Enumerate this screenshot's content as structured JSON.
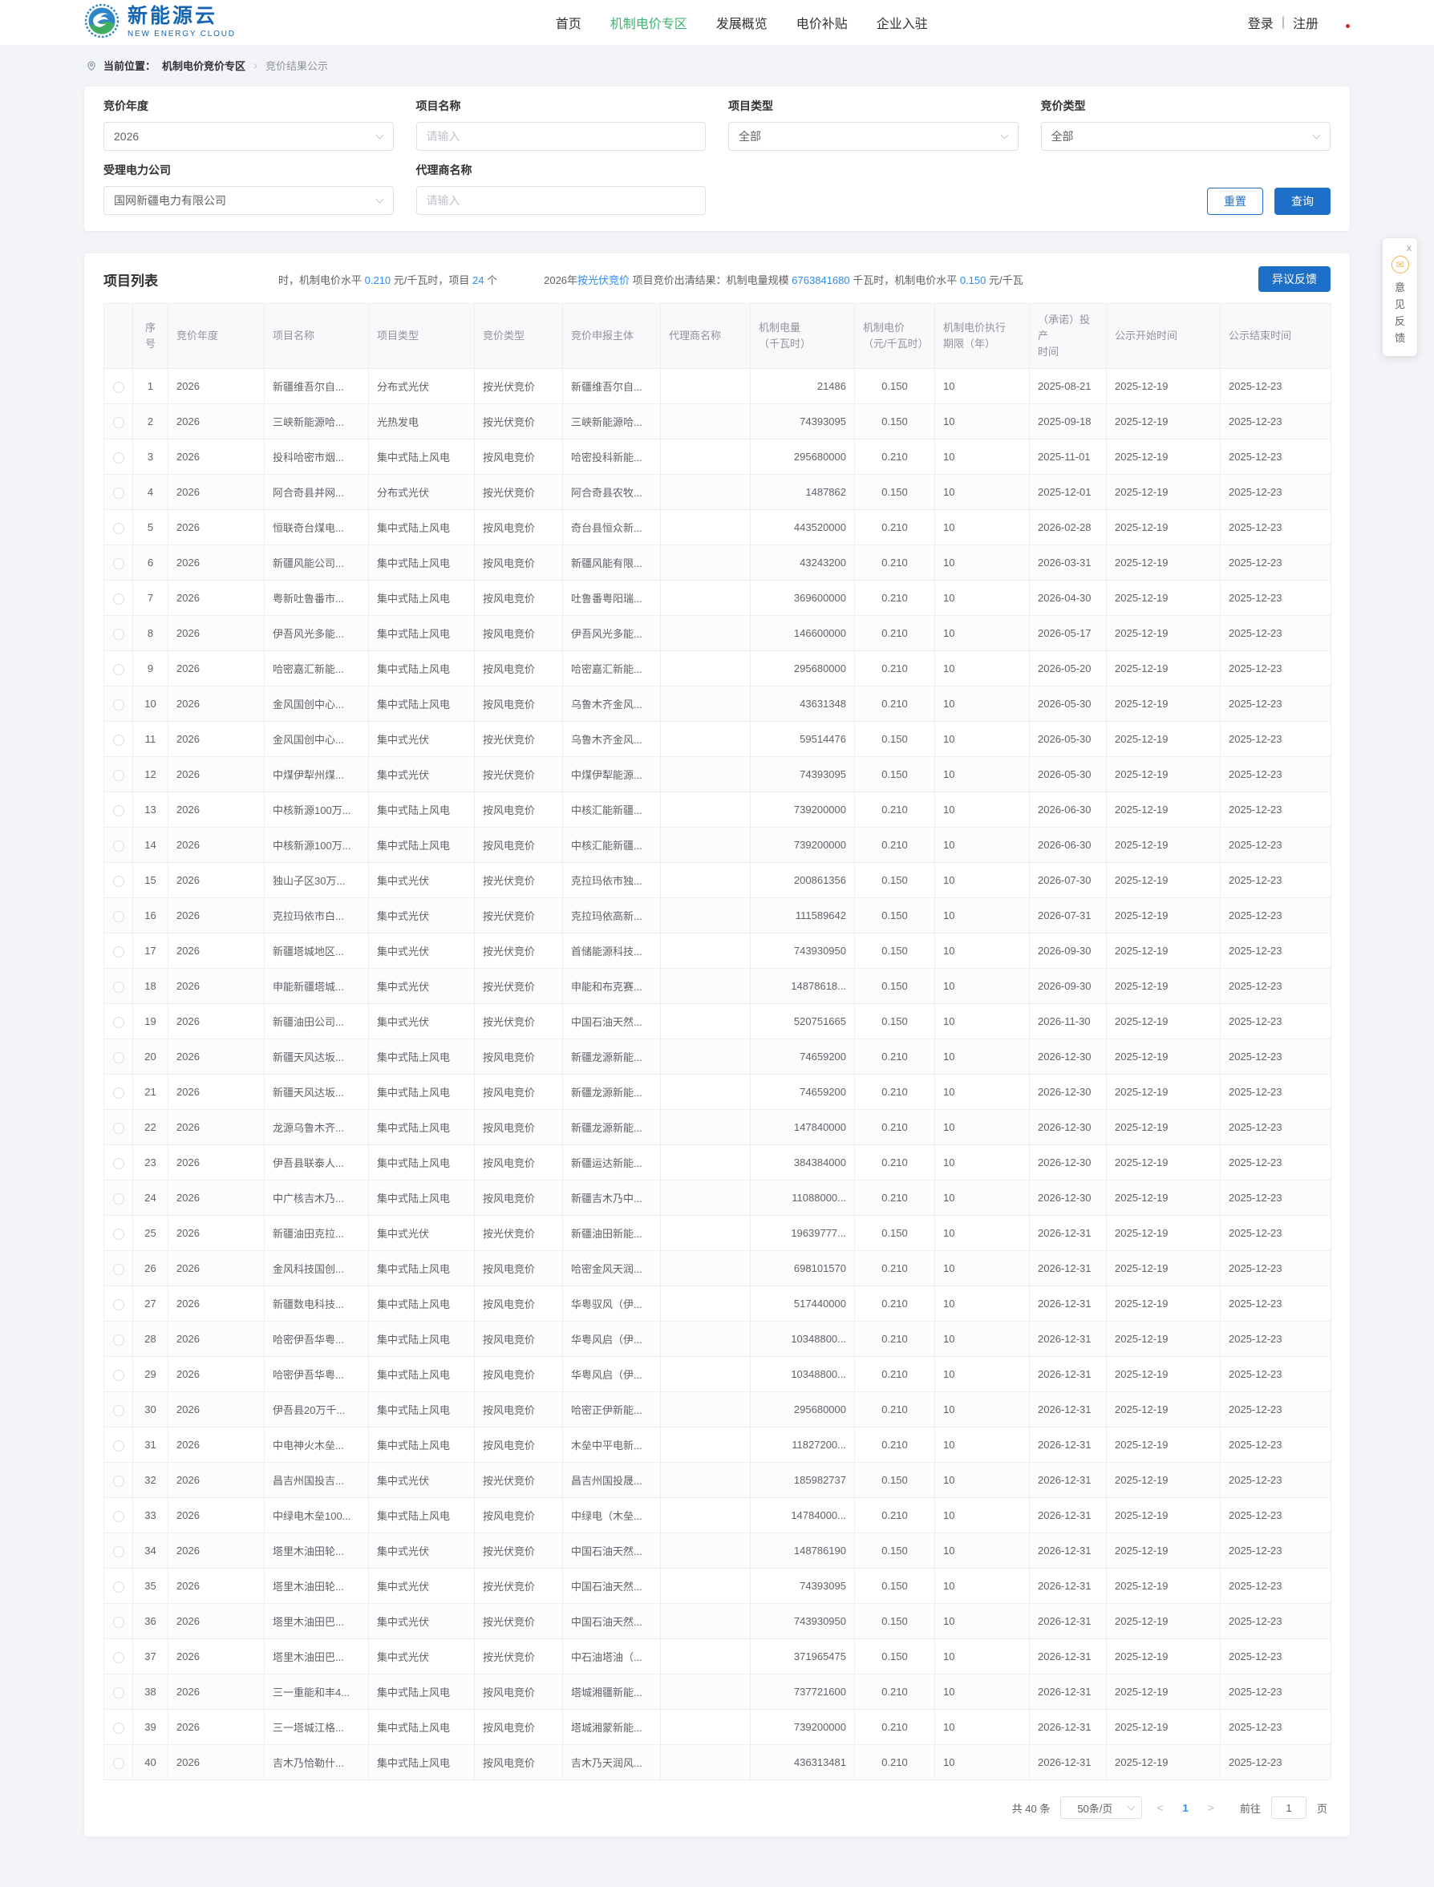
{
  "header": {
    "logo": {
      "title": "新能源云",
      "subtitle": "NEW ENERGY CLOUD"
    },
    "nav": [
      {
        "key": "home",
        "label": "首页",
        "active": false
      },
      {
        "key": "mechanism-price-zone",
        "label": "机制电价专区",
        "active": true
      },
      {
        "key": "development-overview",
        "label": "发展概览",
        "active": false
      },
      {
        "key": "price-subsidy",
        "label": "电价补贴",
        "active": false
      },
      {
        "key": "enterprise-entry",
        "label": "企业入驻",
        "active": false
      }
    ],
    "login": "登录",
    "divider": "|",
    "register": "注册"
  },
  "breadcrumb": {
    "prefix": "当前位置：",
    "section": "机制电价竞价专区",
    "separator": "›",
    "current": "竞价结果公示"
  },
  "filters": {
    "fields": [
      {
        "key": "bidding-year",
        "label": "竞价年度",
        "type": "select",
        "value": "2026"
      },
      {
        "key": "project-name",
        "label": "项目名称",
        "type": "input",
        "placeholder": "请输入"
      },
      {
        "key": "project-type",
        "label": "项目类型",
        "type": "select",
        "value": "全部"
      },
      {
        "key": "bidding-type",
        "label": "竞价类型",
        "type": "select",
        "value": "全部"
      },
      {
        "key": "power-company",
        "label": "受理电力公司",
        "type": "select",
        "value": "国网新疆电力有限公司"
      },
      {
        "key": "agent-name",
        "label": "代理商名称",
        "type": "input",
        "placeholder": "请输入"
      }
    ],
    "reset_label": "重置",
    "search_label": "查询"
  },
  "list": {
    "title": "项目列表",
    "announcement": [
      {
        "text": "时，机制电价水平 "
      },
      {
        "text": "0.210",
        "highlight": true
      },
      {
        "text": " 元/千瓦时，项目 "
      },
      {
        "text": "24",
        "highlight": true
      },
      {
        "text": " 个"
      },
      {
        "text": "2026年 ",
        "gap": true
      },
      {
        "text": "按光伏竞价",
        "highlight": true
      },
      {
        "text": " 项目竞价出清结果：机制电量规模 "
      },
      {
        "text": "6763841680",
        "highlight": true
      },
      {
        "text": " 千瓦时，机制电价水平 "
      },
      {
        "text": "0.150",
        "highlight": true
      },
      {
        "text": " 元/千瓦"
      }
    ],
    "feedback_button": "异议反馈"
  },
  "table": {
    "headers": [
      "",
      "序号",
      "竞价年度",
      "项目名称",
      "项目类型",
      "竞价类型",
      "竞价申报主体",
      "代理商名称",
      "机制电量\n（千瓦时）",
      "机制电价\n（元/千瓦时）",
      "机制电价执行\n期限（年）",
      "（承诺）投产\n时间",
      "公示开始时间",
      "公示结束时间"
    ],
    "rows": [
      [
        "1",
        "2026",
        "新疆维吾尔自...",
        "分布式光伏",
        "按光伏竞价",
        "新疆维吾尔自...",
        "",
        "21486",
        "0.150",
        "10",
        "2025-08-21",
        "2025-12-19",
        "2025-12-23"
      ],
      [
        "2",
        "2026",
        "三峡新能源哈...",
        "光热发电",
        "按光伏竞价",
        "三峡新能源哈...",
        "",
        "74393095",
        "0.150",
        "10",
        "2025-09-18",
        "2025-12-19",
        "2025-12-23"
      ],
      [
        "3",
        "2026",
        "投科哈密市烟...",
        "集中式陆上风电",
        "按风电竞价",
        "哈密投科新能...",
        "",
        "295680000",
        "0.210",
        "10",
        "2025-11-01",
        "2025-12-19",
        "2025-12-23"
      ],
      [
        "4",
        "2026",
        "阿合奇县并网...",
        "分布式光伏",
        "按光伏竞价",
        "阿合奇县农牧...",
        "",
        "1487862",
        "0.150",
        "10",
        "2025-12-01",
        "2025-12-19",
        "2025-12-23"
      ],
      [
        "5",
        "2026",
        "恒联奇台煤电...",
        "集中式陆上风电",
        "按风电竞价",
        "奇台县恒众新...",
        "",
        "443520000",
        "0.210",
        "10",
        "2026-02-28",
        "2025-12-19",
        "2025-12-23"
      ],
      [
        "6",
        "2026",
        "新疆风能公司...",
        "集中式陆上风电",
        "按风电竞价",
        "新疆风能有限...",
        "",
        "43243200",
        "0.210",
        "10",
        "2026-03-31",
        "2025-12-19",
        "2025-12-23"
      ],
      [
        "7",
        "2026",
        "粤新吐鲁番市...",
        "集中式陆上风电",
        "按风电竞价",
        "吐鲁番粤阳瑞...",
        "",
        "369600000",
        "0.210",
        "10",
        "2026-04-30",
        "2025-12-19",
        "2025-12-23"
      ],
      [
        "8",
        "2026",
        "伊吾风光多能...",
        "集中式陆上风电",
        "按风电竞价",
        "伊吾风光多能...",
        "",
        "146600000",
        "0.210",
        "10",
        "2026-05-17",
        "2025-12-19",
        "2025-12-23"
      ],
      [
        "9",
        "2026",
        "哈密嘉汇新能...",
        "集中式陆上风电",
        "按风电竞价",
        "哈密嘉汇新能...",
        "",
        "295680000",
        "0.210",
        "10",
        "2026-05-20",
        "2025-12-19",
        "2025-12-23"
      ],
      [
        "10",
        "2026",
        "金风国创中心...",
        "集中式陆上风电",
        "按风电竞价",
        "乌鲁木齐金风...",
        "",
        "43631348",
        "0.210",
        "10",
        "2026-05-30",
        "2025-12-19",
        "2025-12-23"
      ],
      [
        "11",
        "2026",
        "金风国创中心...",
        "集中式光伏",
        "按光伏竞价",
        "乌鲁木齐金风...",
        "",
        "59514476",
        "0.150",
        "10",
        "2026-05-30",
        "2025-12-19",
        "2025-12-23"
      ],
      [
        "12",
        "2026",
        "中煤伊犁州煤...",
        "集中式光伏",
        "按光伏竞价",
        "中煤伊犁能源...",
        "",
        "74393095",
        "0.150",
        "10",
        "2026-05-30",
        "2025-12-19",
        "2025-12-23"
      ],
      [
        "13",
        "2026",
        "中核新源100万...",
        "集中式陆上风电",
        "按风电竞价",
        "中核汇能新疆...",
        "",
        "739200000",
        "0.210",
        "10",
        "2026-06-30",
        "2025-12-19",
        "2025-12-23"
      ],
      [
        "14",
        "2026",
        "中核新源100万...",
        "集中式陆上风电",
        "按风电竞价",
        "中核汇能新疆...",
        "",
        "739200000",
        "0.210",
        "10",
        "2026-06-30",
        "2025-12-19",
        "2025-12-23"
      ],
      [
        "15",
        "2026",
        "独山子区30万...",
        "集中式光伏",
        "按光伏竞价",
        "克拉玛依市独...",
        "",
        "200861356",
        "0.150",
        "10",
        "2026-07-30",
        "2025-12-19",
        "2025-12-23"
      ],
      [
        "16",
        "2026",
        "克拉玛依市白...",
        "集中式光伏",
        "按光伏竞价",
        "克拉玛依高新...",
        "",
        "111589642",
        "0.150",
        "10",
        "2026-07-31",
        "2025-12-19",
        "2025-12-23"
      ],
      [
        "17",
        "2026",
        "新疆塔城地区...",
        "集中式光伏",
        "按光伏竞价",
        "首储能源科技...",
        "",
        "743930950",
        "0.150",
        "10",
        "2026-09-30",
        "2025-12-19",
        "2025-12-23"
      ],
      [
        "18",
        "2026",
        "申能新疆塔城...",
        "集中式光伏",
        "按光伏竞价",
        "申能和布克赛...",
        "",
        "14878618...",
        "0.150",
        "10",
        "2026-09-30",
        "2025-12-19",
        "2025-12-23"
      ],
      [
        "19",
        "2026",
        "新疆油田公司...",
        "集中式光伏",
        "按光伏竞价",
        "中国石油天然...",
        "",
        "520751665",
        "0.150",
        "10",
        "2026-11-30",
        "2025-12-19",
        "2025-12-23"
      ],
      [
        "20",
        "2026",
        "新疆天风达坂...",
        "集中式陆上风电",
        "按风电竞价",
        "新疆龙源新能...",
        "",
        "74659200",
        "0.210",
        "10",
        "2026-12-30",
        "2025-12-19",
        "2025-12-23"
      ],
      [
        "21",
        "2026",
        "新疆天风达坂...",
        "集中式陆上风电",
        "按风电竞价",
        "新疆龙源新能...",
        "",
        "74659200",
        "0.210",
        "10",
        "2026-12-30",
        "2025-12-19",
        "2025-12-23"
      ],
      [
        "22",
        "2026",
        "龙源乌鲁木齐...",
        "集中式陆上风电",
        "按风电竞价",
        "新疆龙源新能...",
        "",
        "147840000",
        "0.210",
        "10",
        "2026-12-30",
        "2025-12-19",
        "2025-12-23"
      ],
      [
        "23",
        "2026",
        "伊吾县联泰人...",
        "集中式陆上风电",
        "按风电竞价",
        "新疆运达新能...",
        "",
        "384384000",
        "0.210",
        "10",
        "2026-12-30",
        "2025-12-19",
        "2025-12-23"
      ],
      [
        "24",
        "2026",
        "中广核吉木乃...",
        "集中式陆上风电",
        "按风电竞价",
        "新疆吉木乃中...",
        "",
        "11088000...",
        "0.210",
        "10",
        "2026-12-30",
        "2025-12-19",
        "2025-12-23"
      ],
      [
        "25",
        "2026",
        "新疆油田克拉...",
        "集中式光伏",
        "按光伏竞价",
        "新疆油田新能...",
        "",
        "19639777...",
        "0.150",
        "10",
        "2026-12-31",
        "2025-12-19",
        "2025-12-23"
      ],
      [
        "26",
        "2026",
        "金风科技国创...",
        "集中式陆上风电",
        "按风电竞价",
        "哈密金风天润...",
        "",
        "698101570",
        "0.210",
        "10",
        "2026-12-31",
        "2025-12-19",
        "2025-12-23"
      ],
      [
        "27",
        "2026",
        "新疆数电科技...",
        "集中式陆上风电",
        "按风电竞价",
        "华粤驭风（伊...",
        "",
        "517440000",
        "0.210",
        "10",
        "2026-12-31",
        "2025-12-19",
        "2025-12-23"
      ],
      [
        "28",
        "2026",
        "哈密伊吾华粤...",
        "集中式陆上风电",
        "按风电竞价",
        "华粤风启（伊...",
        "",
        "10348800...",
        "0.210",
        "10",
        "2026-12-31",
        "2025-12-19",
        "2025-12-23"
      ],
      [
        "29",
        "2026",
        "哈密伊吾华粤...",
        "集中式陆上风电",
        "按风电竞价",
        "华粤风启（伊...",
        "",
        "10348800...",
        "0.210",
        "10",
        "2026-12-31",
        "2025-12-19",
        "2025-12-23"
      ],
      [
        "30",
        "2026",
        "伊吾县20万千...",
        "集中式陆上风电",
        "按风电竞价",
        "哈密正伊新能...",
        "",
        "295680000",
        "0.210",
        "10",
        "2026-12-31",
        "2025-12-19",
        "2025-12-23"
      ],
      [
        "31",
        "2026",
        "中电神火木垒...",
        "集中式陆上风电",
        "按风电竞价",
        "木垒中平电新...",
        "",
        "11827200...",
        "0.210",
        "10",
        "2026-12-31",
        "2025-12-19",
        "2025-12-23"
      ],
      [
        "32",
        "2026",
        "昌吉州国投吉...",
        "集中式光伏",
        "按光伏竞价",
        "昌吉州国投晟...",
        "",
        "185982737",
        "0.150",
        "10",
        "2026-12-31",
        "2025-12-19",
        "2025-12-23"
      ],
      [
        "33",
        "2026",
        "中绿电木垒100...",
        "集中式陆上风电",
        "按风电竞价",
        "中绿电（木垒...",
        "",
        "14784000...",
        "0.210",
        "10",
        "2026-12-31",
        "2025-12-19",
        "2025-12-23"
      ],
      [
        "34",
        "2026",
        "塔里木油田轮...",
        "集中式光伏",
        "按光伏竞价",
        "中国石油天然...",
        "",
        "148786190",
        "0.150",
        "10",
        "2026-12-31",
        "2025-12-19",
        "2025-12-23"
      ],
      [
        "35",
        "2026",
        "塔里木油田轮...",
        "集中式光伏",
        "按光伏竞价",
        "中国石油天然...",
        "",
        "74393095",
        "0.150",
        "10",
        "2026-12-31",
        "2025-12-19",
        "2025-12-23"
      ],
      [
        "36",
        "2026",
        "塔里木油田巴...",
        "集中式光伏",
        "按光伏竞价",
        "中国石油天然...",
        "",
        "743930950",
        "0.150",
        "10",
        "2026-12-31",
        "2025-12-19",
        "2025-12-23"
      ],
      [
        "37",
        "2026",
        "塔里木油田巴...",
        "集中式光伏",
        "按光伏竞价",
        "中石油塔油（...",
        "",
        "371965475",
        "0.150",
        "10",
        "2026-12-31",
        "2025-12-19",
        "2025-12-23"
      ],
      [
        "38",
        "2026",
        "三一重能和丰4...",
        "集中式陆上风电",
        "按风电竞价",
        "塔城湘疆新能...",
        "",
        "737721600",
        "0.210",
        "10",
        "2026-12-31",
        "2025-12-19",
        "2025-12-23"
      ],
      [
        "39",
        "2026",
        "三一塔城江格...",
        "集中式陆上风电",
        "按风电竞价",
        "塔城湘蒙新能...",
        "",
        "739200000",
        "0.210",
        "10",
        "2026-12-31",
        "2025-12-19",
        "2025-12-23"
      ],
      [
        "40",
        "2026",
        "吉木乃恰勒什...",
        "集中式陆上风电",
        "按风电竞价",
        "吉木乃天润风...",
        "",
        "436313481",
        "0.210",
        "10",
        "2026-12-31",
        "2025-12-19",
        "2025-12-23"
      ]
    ]
  },
  "pagination": {
    "total": "共 40 条",
    "page_size": "50条/页",
    "prev": "<",
    "current_page": "1",
    "next": ">",
    "goto_prefix": "前往",
    "goto_value": "1",
    "goto_suffix": "页"
  },
  "feedback_widget": {
    "close": "x",
    "label": "意见反馈"
  },
  "icons": {
    "mail": "✉"
  },
  "colors": {
    "primary_blue": "#1e6fc8",
    "link_blue": "#2d8cf0",
    "nav_active_green": "#3db370",
    "logo_blue": "#1565b0",
    "accent_yellow": "#f0b33f"
  }
}
